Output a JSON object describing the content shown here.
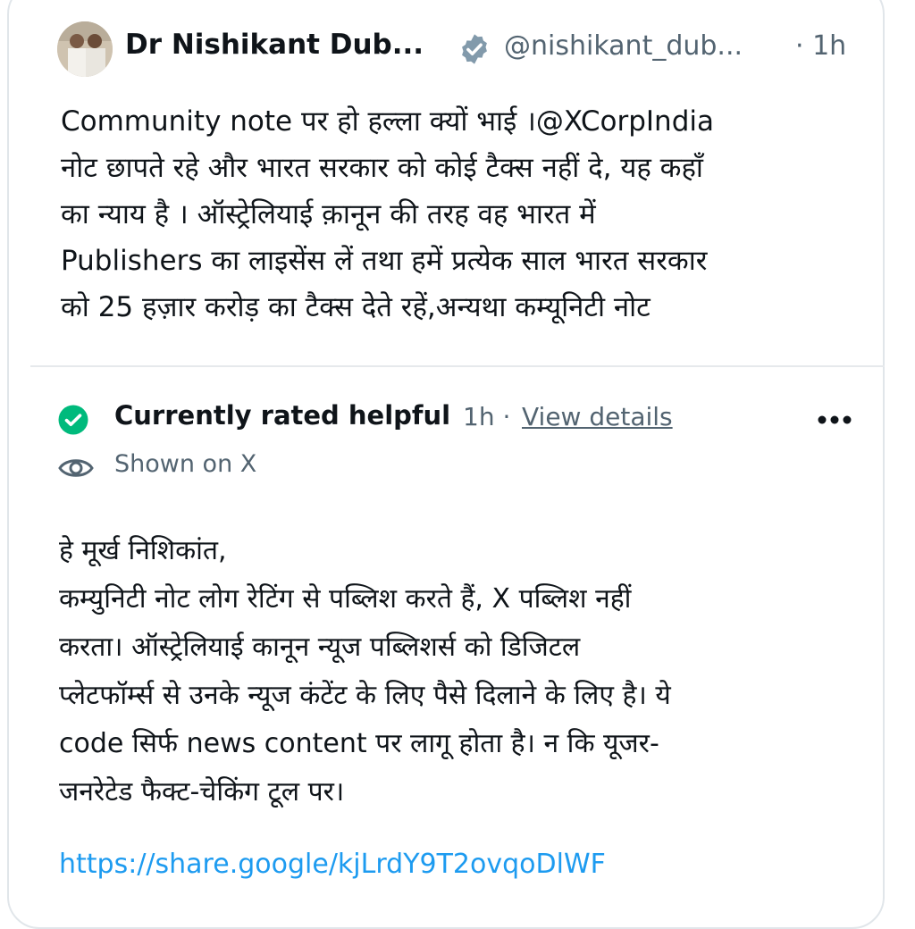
{
  "tweet": {
    "author_name": "Dr Nishikant Dub...",
    "verified_icon": "verified-badge-icon",
    "handle": "@nishikant_dub...",
    "separator": "·",
    "time": "1h",
    "lines": [
      "Community note पर हो हल्ला क्यों भाई ।@XCorpIndia",
      "नोट छापते रहे और भारत सरकार को कोई टैक्स नहीं दे, यह कहाँ",
      "का न्याय है । ऑस्ट्रेलियाई क़ानून की तरह वह भारत में",
      "Publishers का लाइसेंस लें तथा हमें प्रत्येक साल भारत सरकार",
      "को 25 हज़ार करोड़ का टैक्स देते रहें,अन्यथा कम्यूनिटी नोट"
    ]
  },
  "note": {
    "status_icon": "check-circle-icon",
    "status": "Currently rated helpful",
    "time": "1h",
    "separator": "·",
    "view_details": "View details",
    "more_icon": "more-options-icon",
    "shown_icon": "eye-icon",
    "shown_text": "Shown on X",
    "lines": [
      "हे मूर्ख निशिकांत,",
      "कम्युनिटी नोट लोग रेटिंग से पब्लिश करते हैं, X पब्लिश नहीं",
      "करता। ऑस्ट्रेलियाई कानून न्यूज पब्लिशर्स को डिजिटल",
      "प्लेटफॉर्म्स से उनके न्यूज कंटेंट के लिए पैसे दिलाने के लिए है। ये",
      "code सिर्फ news content पर लागू होता है। न कि यूजर-",
      "जनरेटेड फैक्ट-चेकिंग टूल पर।"
    ],
    "link": "https://share.google/kjLrdY9T2ovqoDlWF"
  },
  "colors": {
    "text": "#0f1419",
    "muted": "#536471",
    "link": "#1d9bf0",
    "helpful_green": "#00ba7c",
    "border": "#e1e6ea"
  }
}
